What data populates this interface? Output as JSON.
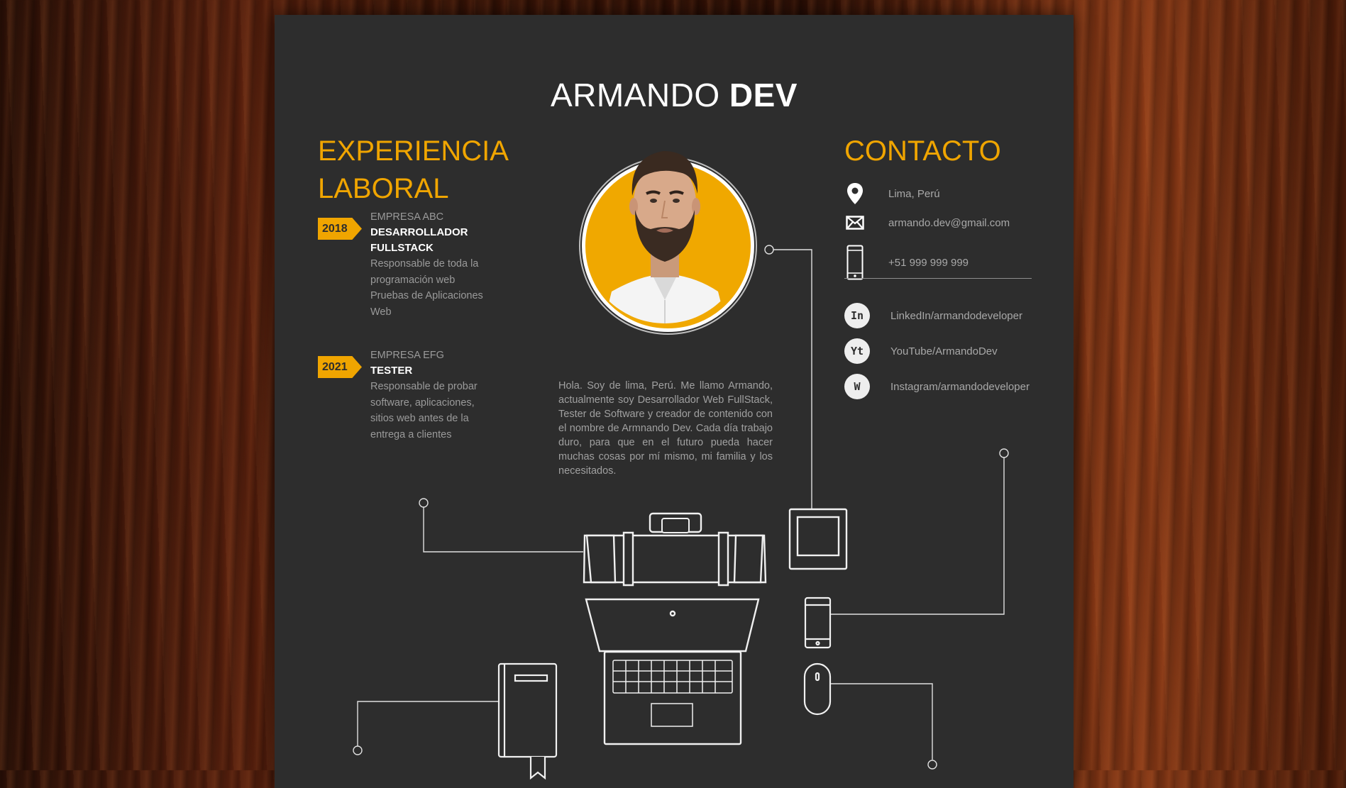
{
  "header": {
    "first_name": "ARMANDO",
    "last_name": "DEV"
  },
  "experience": {
    "title_line1": "EXPERIENCIA",
    "title_line2": "LABORAL",
    "jobs": [
      {
        "year": "2018",
        "company": "EMPRESA ABC",
        "role_line1": "DESARROLLADOR",
        "role_line2": "FULLSTACK",
        "desc_lines": [
          "Responsable de toda la",
          "programación web",
          "Pruebas de Aplicaciones",
          "Web"
        ]
      },
      {
        "year": "2021",
        "company": "EMPRESA EFG",
        "role_line1": "TESTER",
        "role_line2": "",
        "desc_lines": [
          "Responsable de probar",
          "software, aplicaciones,",
          "sitios web antes de la",
          "entrega a clientes"
        ]
      }
    ]
  },
  "bio": "Hola. Soy de lima, Perú. Me llamo Armando, actualmente soy Desarrollador Web FullStack, Tester de Software y creador de contenido con el nombre de Armnando Dev. Cada día trabajo duro, para que en el futuro pueda hacer muchas cosas por mí mismo, mi familia y los necesitados.",
  "contact": {
    "title": "CONTACTO",
    "location": "Lima, Perú",
    "email": "armando.dev@gmail.com",
    "phone": "+51 999 999 999",
    "social": [
      {
        "badge": "In",
        "label": "LinkedIn/armandodeveloper"
      },
      {
        "badge": "Yt",
        "label": "YouTube/ArmandoDev"
      },
      {
        "badge": "W",
        "label": "Instagram/armandodeveloper"
      }
    ]
  },
  "colors": {
    "accent": "#f0a500",
    "sheet_bg": "#2d2d2d",
    "text_muted": "#9a9a9a",
    "text_strong": "#ffffff"
  },
  "icons": {
    "location": "map-pin-icon",
    "email": "envelope-icon",
    "phone": "smartphone-icon",
    "illustrations": [
      "briefcase-icon",
      "tablet-icon",
      "laptop-icon",
      "phone-icon",
      "mouse-icon",
      "notebook-icon"
    ]
  }
}
